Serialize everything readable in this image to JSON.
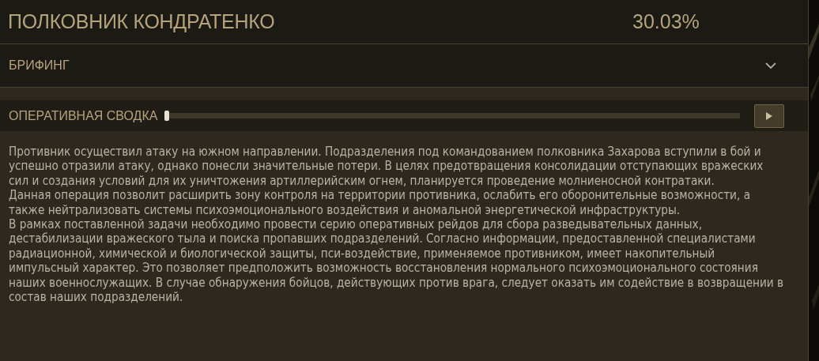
{
  "header": {
    "title": "ПОЛКОВНИК КОНДРАТЕНКО",
    "progress": "30.03%"
  },
  "briefing": {
    "label": "БРИФИНГ",
    "expanded": true
  },
  "audio": {
    "label": "ОПЕРАТИВНАЯ СВОДКА",
    "level": 0.0,
    "playing": false
  },
  "paragraphs": [
    "Противник осуществил атаку на южном направлении. Подразделения под командованием полковника Захарова вступили в бой и успешно отразили атаку, однако понесли значительные потери. В целях предотвращения консолидации отступающих вражеских сил и создания условий для их уничтожения артиллерийским огнем, планируется проведение молниеносной контратаки.",
    "Данная операция позволит расширить зону контроля на территории противника, ослабить его оборонительные возможности, а также нейтрализовать системы психоэмоционального воздействия и аномальной энергетической инфраструктуры.",
    "В рамках поставленной задачи необходимо провести серию оперативных рейдов для сбора разведывательных данных, дестабилизации вражеского тыла и поиска пропавших подразделений. Согласно информации, предоставленной специалистами радиационной, химической и биологической защиты, пси-воздействие, применяемое противником, имеет накопительный импульсный характер. Это позволяет предположить возможность восстановления нормального психоэмоционального состояния наших военнослужащих. В случае обнаружения бойцов, действующих против врага, следует оказать им содействие в возвращении в состав наших подразделений."
  ]
}
